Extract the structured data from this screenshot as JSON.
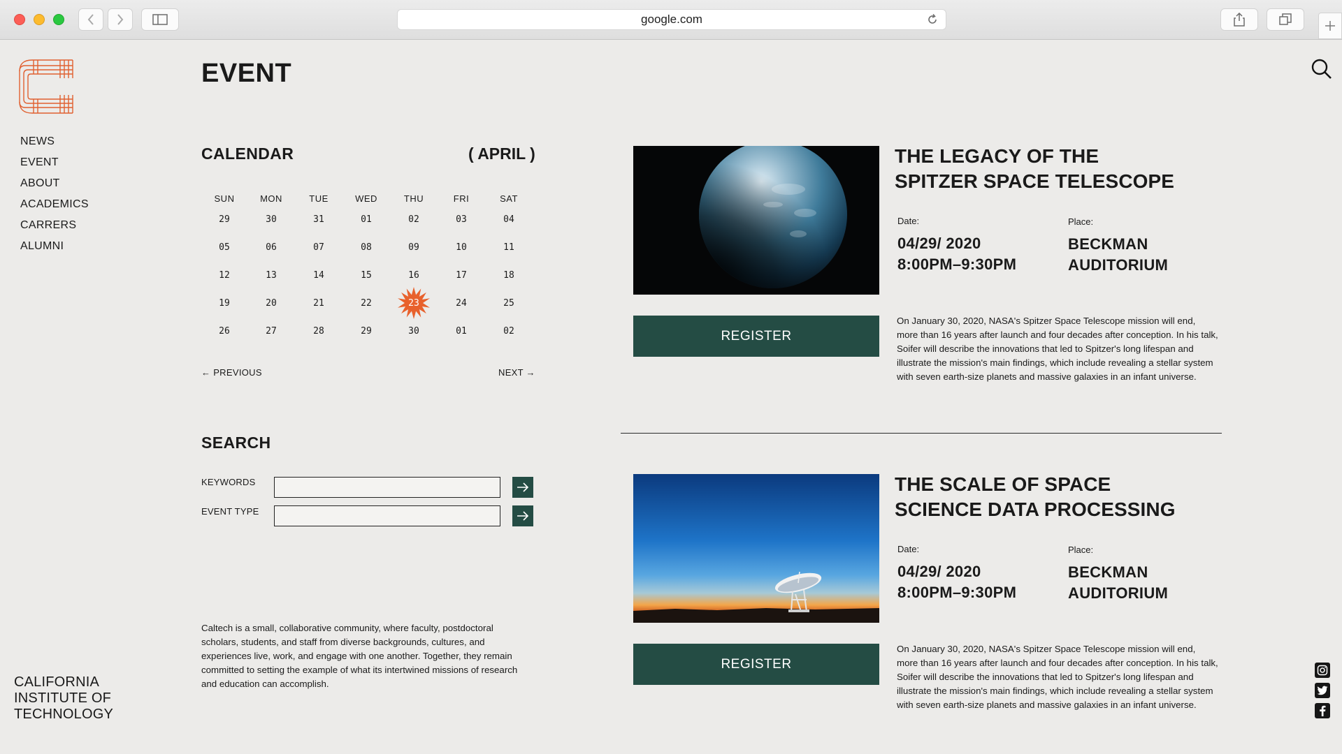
{
  "browser": {
    "url": "google.com"
  },
  "nav": [
    "NEWS",
    "EVENT",
    "ABOUT",
    "ACADEMICS",
    "CARRERS",
    "ALUMNI"
  ],
  "institution": [
    "CALIFORNIA",
    "INSTITUTE OF",
    "TECHNOLOGY"
  ],
  "page_title": "EVENT",
  "calendar": {
    "title": "CALENDAR",
    "month": "( APRIL )",
    "weekdays": [
      "SUN",
      "MON",
      "TUE",
      "WED",
      "THU",
      "FRI",
      "SAT"
    ],
    "weeks": [
      [
        "29",
        "30",
        "31",
        "01",
        "02",
        "03",
        "04"
      ],
      [
        "05",
        "06",
        "07",
        "08",
        "09",
        "10",
        "11"
      ],
      [
        "12",
        "13",
        "14",
        "15",
        "16",
        "17",
        "18"
      ],
      [
        "19",
        "20",
        "21",
        "22",
        "23",
        "24",
        "25"
      ],
      [
        "26",
        "27",
        "28",
        "29",
        "30",
        "01",
        "02"
      ]
    ],
    "selected_day": "23",
    "previous": "← PREVIOUS",
    "next": "NEXT →",
    "accent_color": "#e8612c"
  },
  "search": {
    "title": "SEARCH",
    "keywords_label": "KEYWORDS",
    "keywords_value": "",
    "event_type_label": "EVENT TYPE",
    "event_type_value": ""
  },
  "about": "Caltech is a small, collaborative community, where faculty, postdoctoral scholars, students, and staff from diverse backgrounds, cultures, and experiences live, work, and engage with one another. Together, they remain committed to setting the example of what its intertwined missions of research and education can accomplish.",
  "events": [
    {
      "title_line1": "THE LEGACY OF THE",
      "title_line2": "SPITZER SPACE TELESCOPE",
      "date_label": "Date:",
      "date": "04/29/ 2020",
      "time": "8:00PM–9:30PM",
      "place_label": "Place:",
      "place_line1": "BECKMAN",
      "place_line2": "AUDITORIUM",
      "register": "REGISTER",
      "description": "On January 30, 2020, NASA's Spitzer Space Telescope mission will end, more than 16 years after launch and four decades after conception. In his talk, Soifer will describe the innovations that led to Spitzer's long lifespan and illustrate the mission's main findings, which include revealing a stellar system with seven earth-size planets and massive galaxies in an infant universe.",
      "image": "planet-photo"
    },
    {
      "title_line1": "THE SCALE OF SPACE",
      "title_line2": "SCIENCE DATA PROCESSING",
      "date_label": "Date:",
      "date": "04/29/ 2020",
      "time": "8:00PM–9:30PM",
      "place_label": "Place:",
      "place_line1": "BECKMAN",
      "place_line2": "AUDITORIUM",
      "register": "REGISTER",
      "description": "On January 30, 2020, NASA's Spitzer Space Telescope mission will end, more than 16 years after launch and four decades after conception. In his talk, Soifer will describe the innovations that led to Spitzer's long lifespan and illustrate the mission's main findings, which include revealing a stellar system with seven earth-size planets and massive galaxies in an infant universe.",
      "image": "radio-telescope-photo"
    }
  ],
  "brand_color": "#244c44",
  "social": [
    "instagram-icon",
    "twitter-icon",
    "facebook-icon"
  ]
}
